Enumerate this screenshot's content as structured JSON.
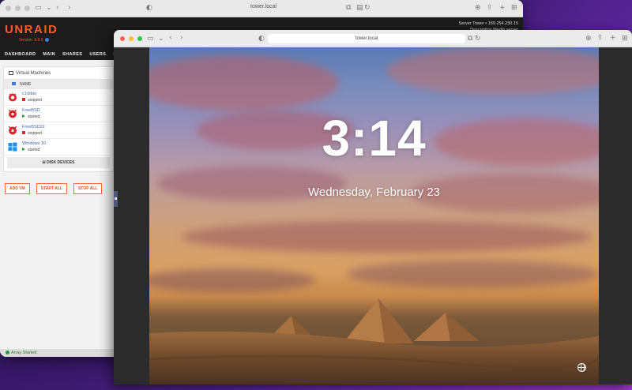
{
  "back_window": {
    "url": "tower.local",
    "brand": "UNRAID",
    "version": "Version: 6.9.2",
    "server_line1": "Server  Tower • 169.254.230.15",
    "server_line2": "Description  Media server",
    "nav": [
      "DASHBOARD",
      "MAIN",
      "SHARES",
      "USERS",
      "SE"
    ],
    "panel_title": "Virtual Machines",
    "column_name": "NAME",
    "vms": [
      {
        "name": "c1rbbio",
        "state": "stopped",
        "icon": "debian-swirl-icon"
      },
      {
        "name": "FreeBSD",
        "state": "started",
        "icon": "freebsd-daemon-icon"
      },
      {
        "name": "FreeBSD22",
        "state": "stopped",
        "icon": "freebsd-daemon-icon"
      },
      {
        "name": "Windows 10",
        "state": "started",
        "icon": "windows-logo-icon"
      }
    ],
    "disk_devices": "DISK DEVICES",
    "buttons": [
      "ADD VM",
      "START ALL",
      "STOP ALL"
    ],
    "status": "Array Started"
  },
  "front_window": {
    "url": "tower.local",
    "time": "3:14",
    "date": "Wednesday, February 23"
  },
  "colors": {
    "unraid_orange": "#ff5a2c",
    "stopped": "#d8282d",
    "started": "#2c9a3a"
  }
}
